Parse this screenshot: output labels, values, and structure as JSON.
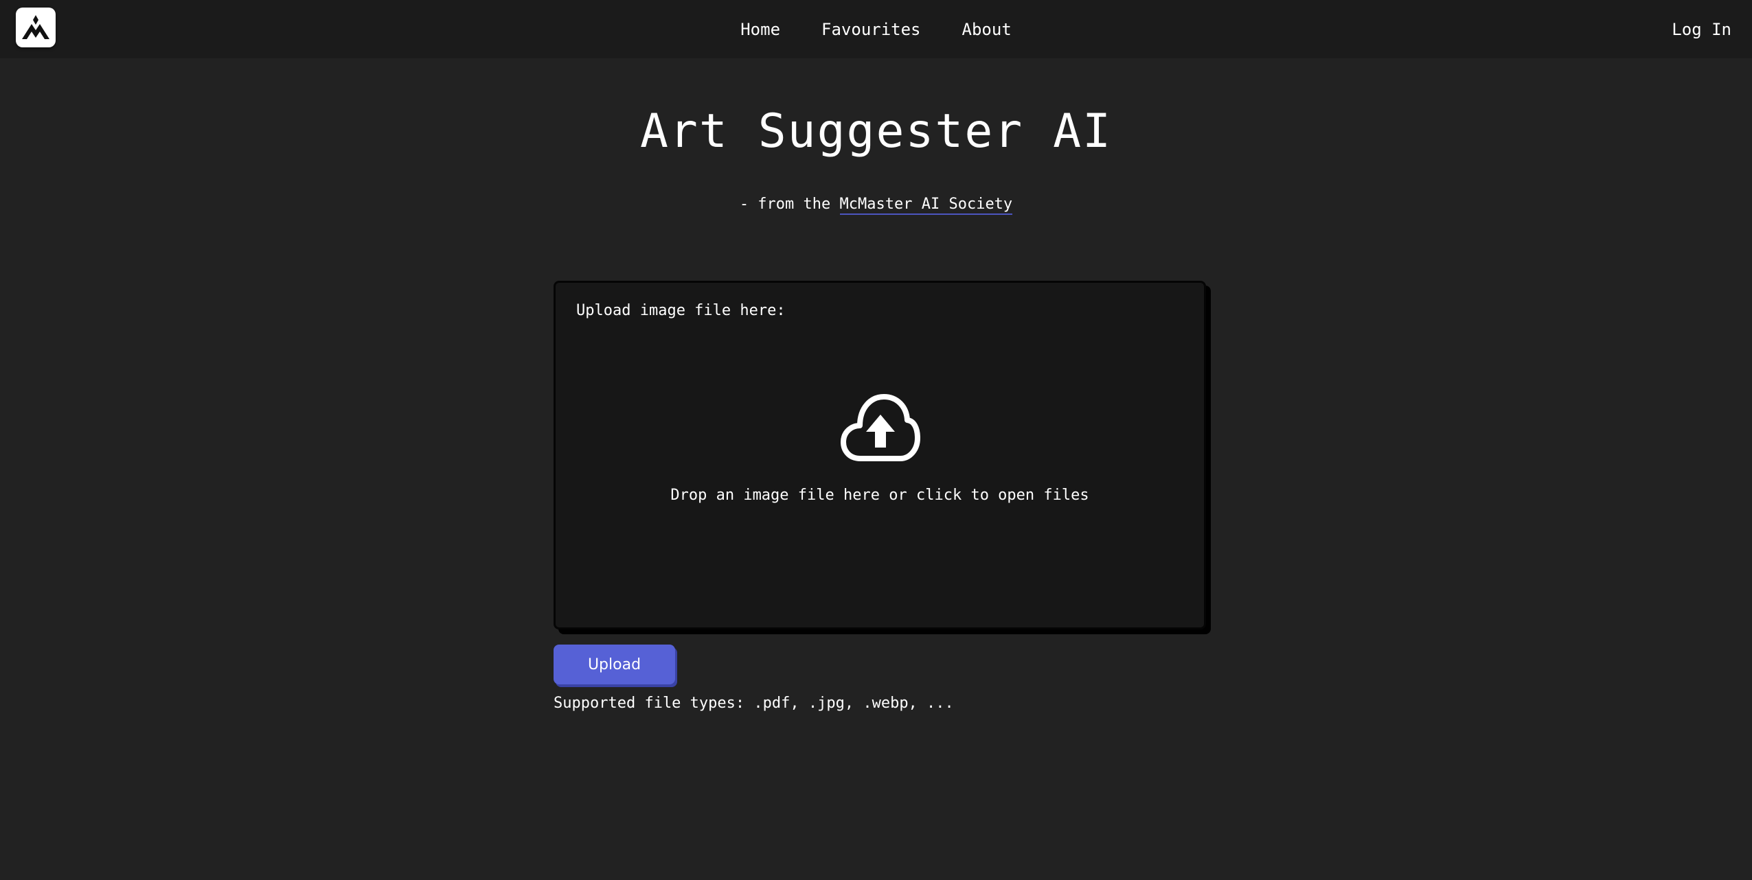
{
  "nav": {
    "logo_icon": "mountain-logo-icon",
    "links": [
      {
        "label": "Home"
      },
      {
        "label": "Favourites"
      },
      {
        "label": "About"
      }
    ],
    "login_label": "Log In"
  },
  "hero": {
    "title": "Art Suggester AI",
    "subtitle_prefix": "- from the ",
    "subtitle_link": "McMaster AI Society"
  },
  "uploader": {
    "label": "Upload image file here:",
    "icon": "cloud-upload-icon",
    "drop_text": "Drop an image file here or click to open files",
    "button_label": "Upload",
    "supported_text": "Supported file types: .pdf, .jpg, .webp, ..."
  },
  "colors": {
    "background": "#222222",
    "navbar": "#1b1b1b",
    "dropzone": "#171717",
    "accent": "#5661d6"
  }
}
